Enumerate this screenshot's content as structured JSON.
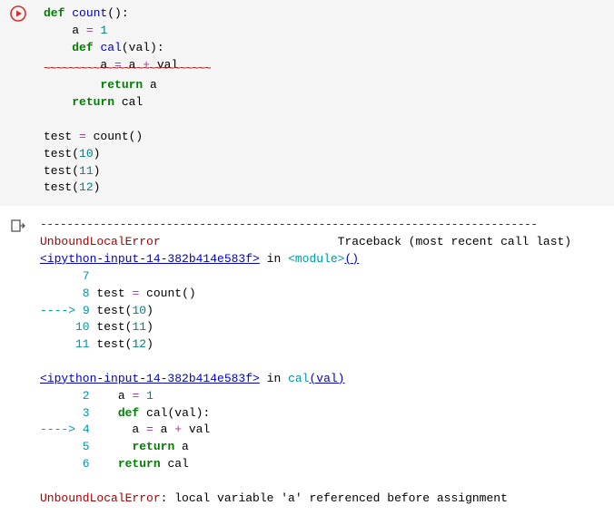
{
  "code": {
    "l1_def": "def",
    "l1_fn": "count",
    "l1_rest": "():",
    "l2_pre": "    a ",
    "l2_eq": "=",
    "l2_sp": " ",
    "l2_num": "1",
    "l3_pre": "    ",
    "l3_def": "def",
    "l3_sp": " ",
    "l3_fn": "cal",
    "l3_rest": "(val):",
    "l4_pre": "        a ",
    "l4_eq1": "=",
    "l4_mid": " a ",
    "l4_plus": "+",
    "l4_end": " val",
    "squiggle": "~~~~~~~~~~~~~~~~~~~~~~~~~~~",
    "l5_pre": "        ",
    "l5_ret": "return",
    "l5_end": " a",
    "l6_pre": "    ",
    "l6_ret": "return",
    "l6_end": " cal",
    "blank": "",
    "l8_a": "test ",
    "l8_eq": "=",
    "l8_b": " count()",
    "l9_a": "test(",
    "l9_n": "10",
    "l9_b": ")",
    "l10_a": "test(",
    "l10_n": "11",
    "l10_b": ")",
    "l11_a": "test(",
    "l11_n": "12",
    "l11_b": ")"
  },
  "traceback": {
    "dashes": "---------------------------------------------------------------------------",
    "err_name": "UnboundLocalError",
    "header_rest": "                         Traceback (most recent call last)",
    "frame1_link": "<ipython-input-14-382b414e583f>",
    "frame1_in": " in ",
    "frame1_mod": "<module>",
    "frame1_par": "()",
    "f1_l7": "      7 ",
    "f1_l8a": "      8 ",
    "f1_l8b": "test ",
    "f1_l8c": "=",
    "f1_l8d": " count",
    "f1_l8e": "(",
    "f1_l8f": ")",
    "arrow": "----> ",
    "f1_l9n": "9 ",
    "f1_l9a": "test",
    "f1_l9b": "(",
    "f1_l9c": "10",
    "f1_l9d": ")",
    "f1_l10a": "     10 ",
    "f1_l10b": "test",
    "f1_l10c": "(",
    "f1_l10d": "11",
    "f1_l10e": ")",
    "f1_l11a": "     11 ",
    "f1_l11b": "test",
    "f1_l11c": "(",
    "f1_l11d": "12",
    "f1_l11e": ")",
    "frame2_link": "<ipython-input-14-382b414e583f>",
    "frame2_in": " in ",
    "frame2_fn": "cal",
    "frame2_par": "(val)",
    "f2_l2a": "      2 ",
    "f2_l2b": "   a ",
    "f2_l2c": "=",
    "f2_l2d": " ",
    "f2_l2e": "1",
    "f2_l3a": "      3 ",
    "f2_l3b": "   ",
    "f2_l3c": "def",
    "f2_l3d": " cal",
    "f2_l3e": "(",
    "f2_l3f": "val",
    "f2_l3g": ")",
    "f2_l3h": ":",
    "f2_l4n": "4 ",
    "f2_l4a": "     a ",
    "f2_l4b": "=",
    "f2_l4c": " a ",
    "f2_l4d": "+",
    "f2_l4e": " val",
    "f2_l5a": "      5 ",
    "f2_l5b": "     ",
    "f2_l5c": "return",
    "f2_l5d": " a",
    "f2_l6a": "      6 ",
    "f2_l6b": "   ",
    "f2_l6c": "return",
    "f2_l6d": " cal",
    "final_err": "UnboundLocalError",
    "final_msg": ": local variable 'a' referenced before assignment"
  }
}
